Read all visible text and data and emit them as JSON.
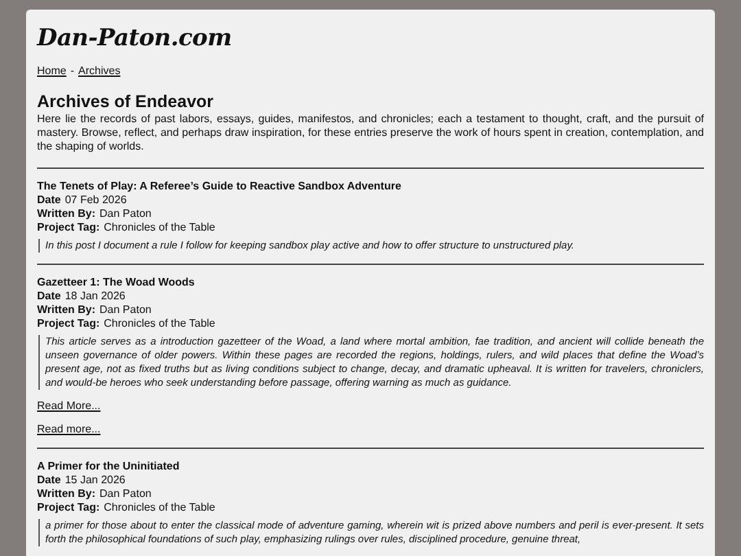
{
  "site_title": "Dan-Paton.com",
  "breadcrumb": [
    {
      "label": "Home"
    },
    {
      "label": "Archives"
    }
  ],
  "breadcrumb_separator": "-",
  "heading": "Archives of Endeavor",
  "intro": "Here lie the records of past labors, essays, guides, manifestos, and chronicles; each a testament to thought, craft, and the pursuit of mastery. Browse, reflect, and perhaps draw inspiration, for these entries preserve the work of hours spent in creation, contemplation, and the shaping of worlds.",
  "entries": [
    {
      "title": "The Tenets of Play: A Referee’s Guide to Reactive Sandbox Adventure",
      "date_label": "Date",
      "date": "07 Feb 2026",
      "author_label": "Written By:",
      "author": "Dan Paton",
      "tag_label": "Project Tag:",
      "tag": "Chronicles of the Table",
      "summary": "In this post I document a rule I follow for keeping sandbox play active and how to offer structure to unstructured play."
    },
    {
      "title": "Gazetteer 1: The Woad Woods",
      "date_label": "Date",
      "date": "18 Jan 2026",
      "author_label": "Written By:",
      "author": "Dan Paton",
      "tag_label": "Project Tag:",
      "tag": "Chronicles of the Table",
      "summary": "This article serves as a introduction gazetteer of the Woad, a land where mortal ambition, fae tradition, and ancient will collide beneath the unseen governance of older powers. Within these pages are recorded the regions, holdings, rulers, and wild places that define the Woad’s present age, not as fixed truths but as living conditions subject to change, decay, and dramatic upheaval. It is written for travelers, chroniclers, and would-be heroes who seek understanding before passage, offering warning as much as guidance.",
      "links": [
        "Read More...",
        "Read more..."
      ]
    },
    {
      "title": "A Primer for the Uninitiated",
      "date_label": "Date",
      "date": "15 Jan 2026",
      "author_label": "Written By:",
      "author": "Dan Paton",
      "tag_label": "Project Tag:",
      "tag": "Chronicles of the Table",
      "summary": "a primer for those about to enter the classical mode of adventure gaming, wherein wit is prized above numbers and peril is ever-present. It sets forth the philosophical foundations of such play, emphasizing rulings over rules, disciplined procedure, genuine threat,"
    }
  ]
}
